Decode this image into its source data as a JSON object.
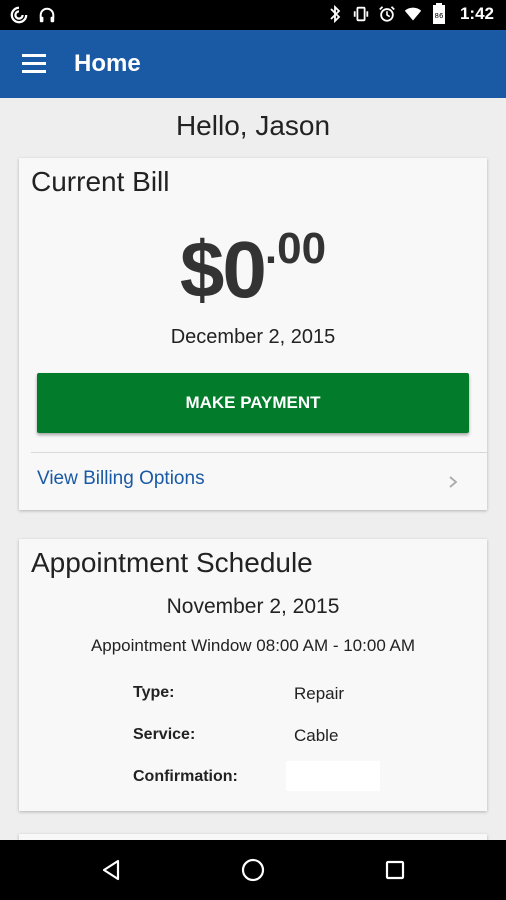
{
  "status_bar": {
    "time": "1:42",
    "icons_left": [
      "sync-icon",
      "headphones-icon"
    ],
    "icons_right": [
      "bluetooth-icon",
      "vibrate-icon",
      "alarm-icon",
      "wifi-icon",
      "battery-icon"
    ],
    "battery_label": "86"
  },
  "app_bar": {
    "title": "Home",
    "menu_icon": "hamburger-menu-icon",
    "color": "#1a5aa5"
  },
  "greeting": "Hello, Jason",
  "current_bill": {
    "title": "Current Bill",
    "amount_whole": "$0",
    "amount_cents": ".00",
    "date": "December 2, 2015",
    "pay_button_label": "MAKE PAYMENT",
    "pay_button_color": "#027c2a",
    "billing_options_label": "View Billing Options"
  },
  "appointment": {
    "title": "Appointment Schedule",
    "date": "November 2, 2015",
    "window": "Appointment Window 08:00 AM - 10:00 AM",
    "details": [
      {
        "label": "Type:",
        "value": "Repair"
      },
      {
        "label": "Service:",
        "value": "Cable"
      },
      {
        "label": "Confirmation:",
        "value": ""
      }
    ]
  },
  "nav_bar": {
    "buttons": [
      "back-icon",
      "home-icon",
      "recents-icon"
    ]
  }
}
